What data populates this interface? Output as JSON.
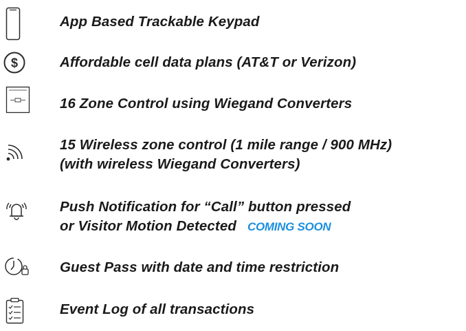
{
  "colors": {
    "text": "#1a1a1a",
    "icon": "#2b2b2b",
    "badge": "#1c8fe0"
  },
  "features": [
    {
      "icon": "smartphone-icon",
      "lines": [
        "App Based Trackable Keypad"
      ]
    },
    {
      "icon": "dollar-circle-icon",
      "lines": [
        "Affordable cell data plans (AT&T or Verizon)"
      ]
    },
    {
      "icon": "converter-board-icon",
      "lines": [
        "16 Zone Control using Wiegand Converters"
      ]
    },
    {
      "icon": "wireless-signal-icon",
      "lines": [
        "15 Wireless zone control (1 mile range / 900 MHz)",
        "(with wireless Wiegand Converters)"
      ]
    },
    {
      "icon": "ringing-bell-icon",
      "lines": [
        "Push Notification for “Call” button pressed",
        "or Visitor Motion Detected"
      ],
      "badge": "COMING SOON"
    },
    {
      "icon": "clock-lock-icon",
      "lines": [
        "Guest Pass with date and time restriction"
      ]
    },
    {
      "icon": "checklist-clipboard-icon",
      "lines": [
        "Event Log of all transactions"
      ]
    }
  ]
}
